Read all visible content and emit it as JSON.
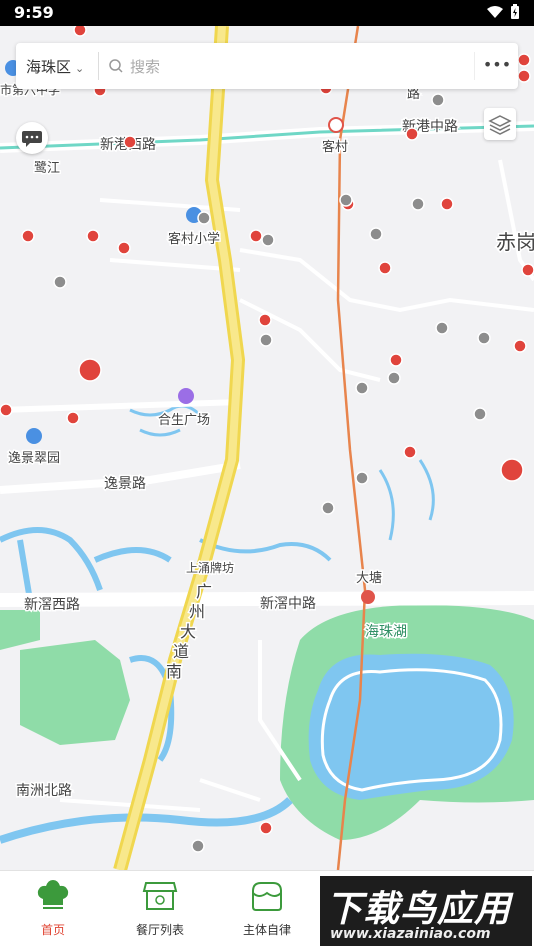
{
  "status_bar": {
    "time": "9:59"
  },
  "search": {
    "district": "海珠区",
    "placeholder": "搜索"
  },
  "map_labels": {
    "xingang_west": "新港西路",
    "xingang_mid": "新港中路",
    "kecun": "客村",
    "lujiang": "鹭江",
    "kecun_school": "客村小学",
    "chigang": "赤岗",
    "hesheng": "合生广场",
    "yijing_garden": "逸景翠园",
    "yijing_road": "逸景路",
    "shangyong": "上涌牌坊",
    "dasha": "大塘",
    "xinjiao_west": "新滘西路",
    "xinjiao_mid": "新滘中路",
    "avenue_1": "广",
    "avenue_2": "州",
    "avenue_3": "大",
    "avenue_4": "道",
    "avenue_5": "南",
    "lake": "海珠湖",
    "nanzhou": "南洲北路",
    "top_left_school": "市第六中学",
    "top_road": "路"
  },
  "tabs": [
    {
      "label": "首页",
      "active": true
    },
    {
      "label": "餐厅列表",
      "active": false
    },
    {
      "label": "主体自律",
      "active": false
    }
  ],
  "watermark": {
    "title": "下载鸟应用",
    "url": "www.xiazainiao.com"
  }
}
